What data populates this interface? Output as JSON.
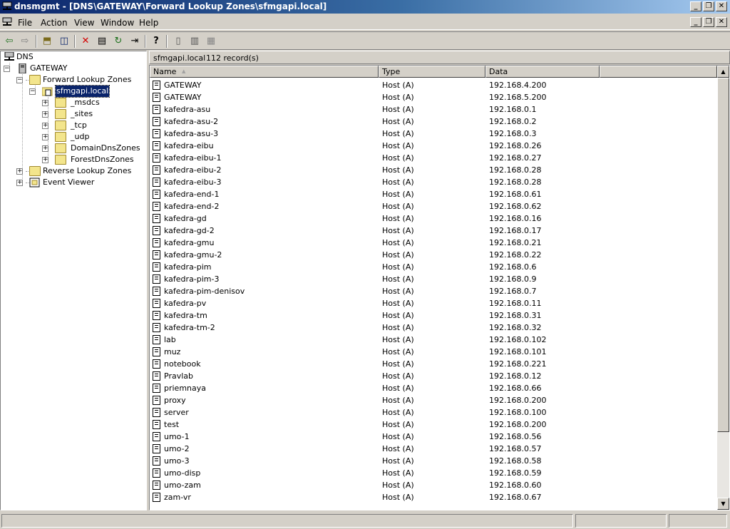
{
  "window": {
    "title": "dnsmgmt - [DNS\\GATEWAY\\Forward Lookup Zones\\sfmgapi.local]",
    "min_glyph": "_",
    "restore_glyph": "❐",
    "close_glyph": "✕"
  },
  "menu": {
    "items": [
      {
        "label": "File"
      },
      {
        "label": "Action"
      },
      {
        "label": "View"
      },
      {
        "label": "Window"
      },
      {
        "label": "Help"
      }
    ]
  },
  "toolbar": {
    "back_glyph": "⇦",
    "forward_glyph": "⇨",
    "up_glyph": "⬒",
    "showhide_glyph": "◫",
    "delete_glyph": "✕",
    "properties_glyph": "▤",
    "refresh_glyph": "↻",
    "export_glyph": "⇥",
    "help_glyph": "?",
    "server_glyph": "▯",
    "record_glyph": "▥",
    "zone_glyph": "▦"
  },
  "tree": {
    "root": "DNS",
    "server": "GATEWAY",
    "forward_zones": "Forward Lookup Zones",
    "zone": "sfmgapi.local",
    "subfolders": [
      "_msdcs",
      "_sites",
      "_tcp",
      "_udp",
      "DomainDnsZones",
      "ForestDnsZones"
    ],
    "reverse_zones": "Reverse Lookup Zones",
    "event_viewer": "Event Viewer",
    "expand_plus": "+",
    "expand_minus": "−"
  },
  "details": {
    "zone_name": "sfmgapi.local",
    "record_count": "112 record(s)",
    "columns": [
      {
        "label": "Name"
      },
      {
        "label": "Type"
      },
      {
        "label": "Data"
      }
    ],
    "sort_glyph": "▲",
    "rows": [
      {
        "name": "GATEWAY",
        "type": "Host (A)",
        "data": "192.168.4.200"
      },
      {
        "name": "GATEWAY",
        "type": "Host (A)",
        "data": "192.168.5.200"
      },
      {
        "name": "kafedra-asu",
        "type": "Host (A)",
        "data": "192.168.0.1"
      },
      {
        "name": "kafedra-asu-2",
        "type": "Host (A)",
        "data": "192.168.0.2"
      },
      {
        "name": "kafedra-asu-3",
        "type": "Host (A)",
        "data": "192.168.0.3"
      },
      {
        "name": "kafedra-eibu",
        "type": "Host (A)",
        "data": "192.168.0.26"
      },
      {
        "name": "kafedra-eibu-1",
        "type": "Host (A)",
        "data": "192.168.0.27"
      },
      {
        "name": "kafedra-eibu-2",
        "type": "Host (A)",
        "data": "192.168.0.28"
      },
      {
        "name": "kafedra-eibu-3",
        "type": "Host (A)",
        "data": "192.168.0.28"
      },
      {
        "name": "kafedra-end-1",
        "type": "Host (A)",
        "data": "192.168.0.61"
      },
      {
        "name": "kafedra-end-2",
        "type": "Host (A)",
        "data": "192.168.0.62"
      },
      {
        "name": "kafedra-gd",
        "type": "Host (A)",
        "data": "192.168.0.16"
      },
      {
        "name": "kafedra-gd-2",
        "type": "Host (A)",
        "data": "192.168.0.17"
      },
      {
        "name": "kafedra-gmu",
        "type": "Host (A)",
        "data": "192.168.0.21"
      },
      {
        "name": "kafedra-gmu-2",
        "type": "Host (A)",
        "data": "192.168.0.22"
      },
      {
        "name": "kafedra-pim",
        "type": "Host (A)",
        "data": "192.168.0.6"
      },
      {
        "name": "kafedra-pim-3",
        "type": "Host (A)",
        "data": "192.168.0.9"
      },
      {
        "name": "kafedra-pim-denisov",
        "type": "Host (A)",
        "data": "192.168.0.7"
      },
      {
        "name": "kafedra-pv",
        "type": "Host (A)",
        "data": "192.168.0.11"
      },
      {
        "name": "kafedra-tm",
        "type": "Host (A)",
        "data": "192.168.0.31"
      },
      {
        "name": "kafedra-tm-2",
        "type": "Host (A)",
        "data": "192.168.0.32"
      },
      {
        "name": "lab",
        "type": "Host (A)",
        "data": "192.168.0.102"
      },
      {
        "name": "muz",
        "type": "Host (A)",
        "data": "192.168.0.101"
      },
      {
        "name": "notebook",
        "type": "Host (A)",
        "data": "192.168.0.221"
      },
      {
        "name": "Pravlab",
        "type": "Host (A)",
        "data": "192.168.0.12"
      },
      {
        "name": "priemnaya",
        "type": "Host (A)",
        "data": "192.168.0.66"
      },
      {
        "name": "proxy",
        "type": "Host (A)",
        "data": "192.168.0.200"
      },
      {
        "name": "server",
        "type": "Host (A)",
        "data": "192.168.0.100"
      },
      {
        "name": "test",
        "type": "Host (A)",
        "data": "192.168.0.200"
      },
      {
        "name": "umo-1",
        "type": "Host (A)",
        "data": "192.168.0.56"
      },
      {
        "name": "umo-2",
        "type": "Host (A)",
        "data": "192.168.0.57"
      },
      {
        "name": "umo-3",
        "type": "Host (A)",
        "data": "192.168.0.58"
      },
      {
        "name": "umo-disp",
        "type": "Host (A)",
        "data": "192.168.0.59"
      },
      {
        "name": "umo-zam",
        "type": "Host (A)",
        "data": "192.168.0.60"
      },
      {
        "name": "zam-vr",
        "type": "Host (A)",
        "data": "192.168.0.67"
      }
    ],
    "scroll_up_glyph": "▲",
    "scroll_down_glyph": "▼"
  },
  "colors": {
    "titlebar": "#0a246a",
    "selection": "#0a246a",
    "face": "#d4d0c8"
  }
}
